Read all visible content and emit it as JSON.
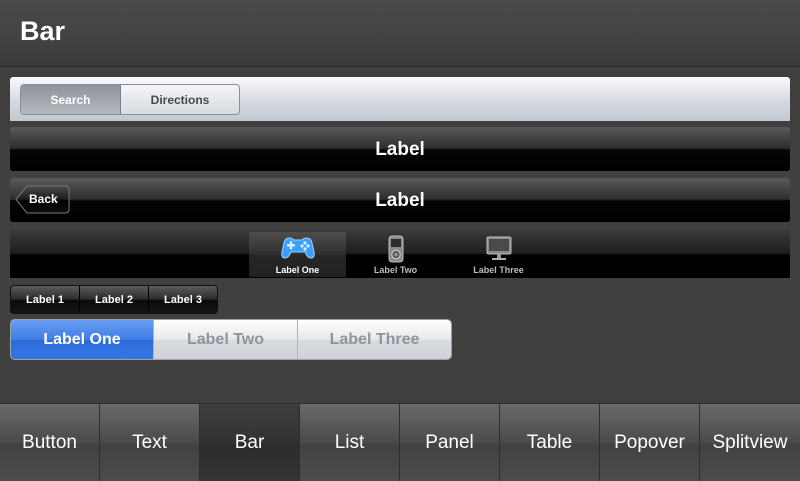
{
  "header": {
    "title": "Bar"
  },
  "light_segmented": {
    "items": [
      "Search",
      "Directions"
    ],
    "selected": "Search"
  },
  "label_bar": {
    "label": "Label"
  },
  "nav_bar": {
    "back_label": "Back",
    "label": "Label"
  },
  "tab_bar": {
    "items": [
      {
        "label": "Label One",
        "icon": "gamepad-icon"
      },
      {
        "label": "Label Two",
        "icon": "music-player-icon"
      },
      {
        "label": "Label Three",
        "icon": "monitor-icon"
      }
    ],
    "selected": "Label One"
  },
  "small_segmented": {
    "items": [
      "Label 1",
      "Label 2",
      "Label 3"
    ]
  },
  "large_segmented": {
    "items": [
      "Label One",
      "Label Two",
      "Label Three"
    ],
    "selected": "Label One"
  },
  "bottom_tabs": {
    "items": [
      "Button",
      "Text",
      "Bar",
      "List",
      "Panel",
      "Table",
      "Popover",
      "Splitview"
    ],
    "selected": "Bar"
  },
  "colors": {
    "accent": "#3f7de6",
    "background": "#404040",
    "tab_icon_active": "#3aa0ff"
  }
}
